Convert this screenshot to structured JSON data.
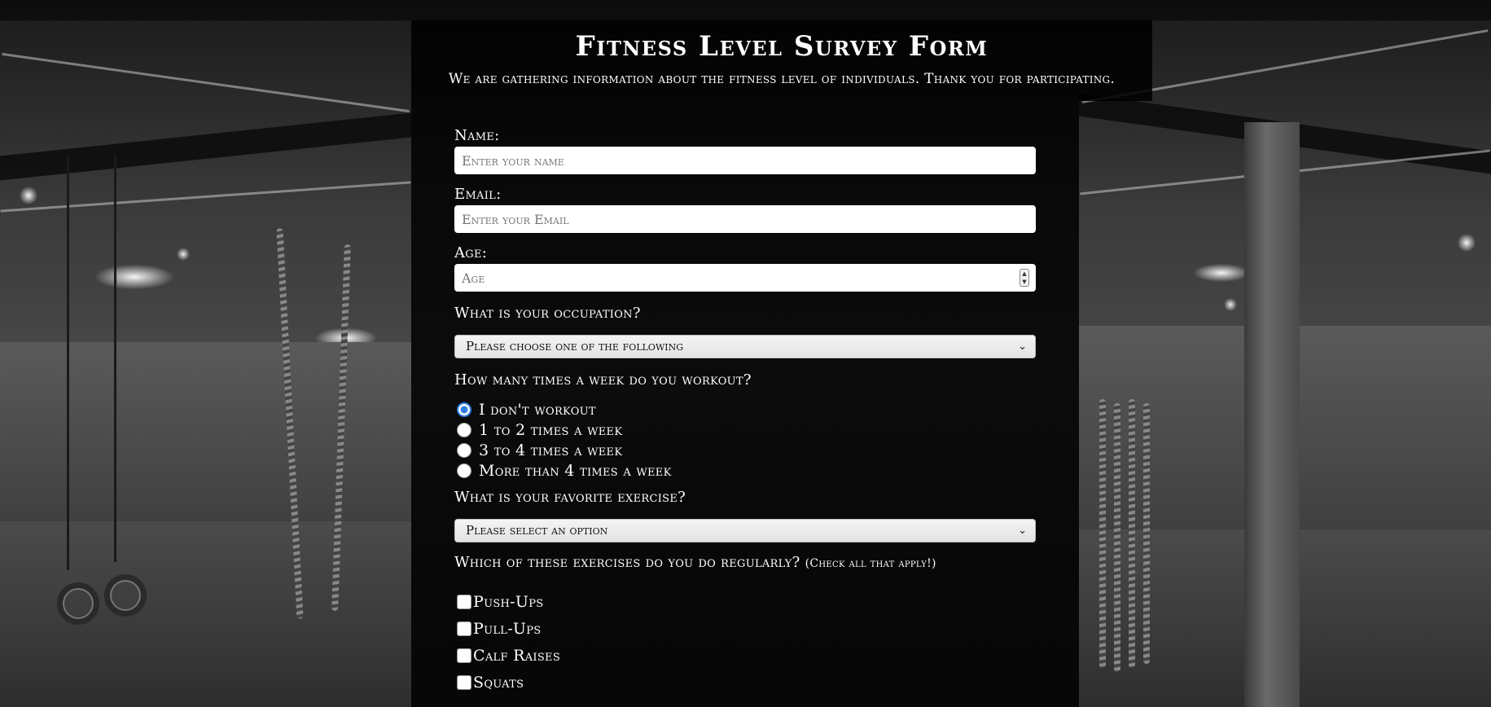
{
  "header": {
    "title": "Fitness Level Survey Form",
    "subtitle": "We are gathering information about the fitness level of individuals. Thank you for participating."
  },
  "form": {
    "name": {
      "label": "Name:",
      "placeholder": "Enter your name",
      "value": ""
    },
    "email": {
      "label": "Email:",
      "placeholder": "Enter your Email",
      "value": ""
    },
    "age": {
      "label": "Age:",
      "placeholder": "Age",
      "value": ""
    },
    "occupation": {
      "label": "What is your occupation?",
      "selected": "Please choose one of the following"
    },
    "workout_frequency": {
      "label": "How many times a week do you workout?",
      "options": [
        {
          "label": "I don't workout",
          "checked": true
        },
        {
          "label": "1 to 2 times a week",
          "checked": false
        },
        {
          "label": "3 to 4 times a week",
          "checked": false
        },
        {
          "label": "More than 4 times a week",
          "checked": false
        }
      ]
    },
    "favorite_exercise": {
      "label": "What is your favorite exercise?",
      "selected": "Please select an option"
    },
    "regular_exercises": {
      "label": "Which of these exercises do you do regularly?",
      "note": "(Check all that apply!)",
      "options": [
        {
          "label": "Push-Ups",
          "checked": false
        },
        {
          "label": "Pull-Ups",
          "checked": false
        },
        {
          "label": "Calf Raises",
          "checked": false
        },
        {
          "label": "Squats",
          "checked": false
        }
      ]
    }
  },
  "colors": {
    "radio_accent": "#2f7de1",
    "panel_bg": "rgba(0,0,0,0.84)",
    "text": "#ffffff"
  },
  "icons": {
    "select_arrow": "chevron-down-icon",
    "number_spinner": "spinner-icon"
  }
}
